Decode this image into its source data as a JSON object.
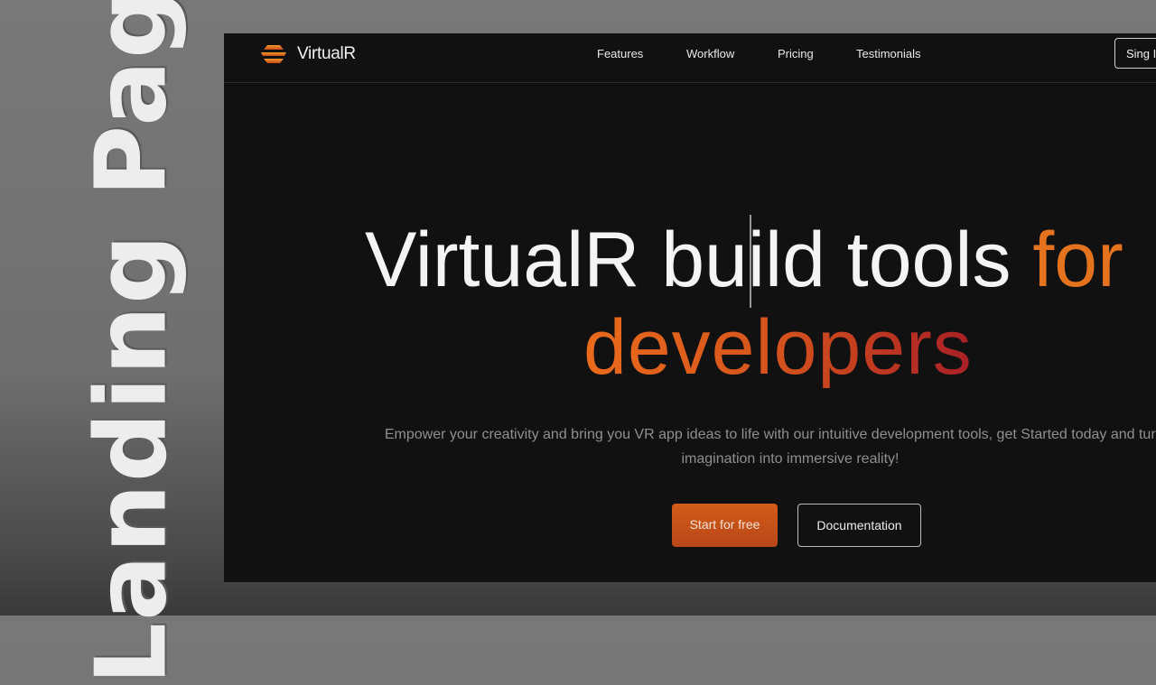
{
  "side_title": "Landing Page",
  "brand": {
    "name": "VirtualR"
  },
  "nav": {
    "links": [
      "Features",
      "Workflow",
      "Pricing",
      "Testimonials"
    ],
    "signin_label": "Sing In"
  },
  "hero": {
    "headline_main": "VirtualR build tools ",
    "headline_accent": "for",
    "headline_line2": "developers",
    "subtitle": "Empower your creativity and bring you VR app ideas to life with our intuitive development tools, get Started today and turn your imagination into immersive reality!",
    "primary_cta": "Start for free",
    "secondary_cta": "Documentation"
  },
  "colors": {
    "accent": "#e5731d",
    "gradient_start": "#ea6b1b",
    "gradient_end": "#a91f26",
    "background": "#111111"
  },
  "icons": {
    "logo": "layered-logo-icon"
  }
}
